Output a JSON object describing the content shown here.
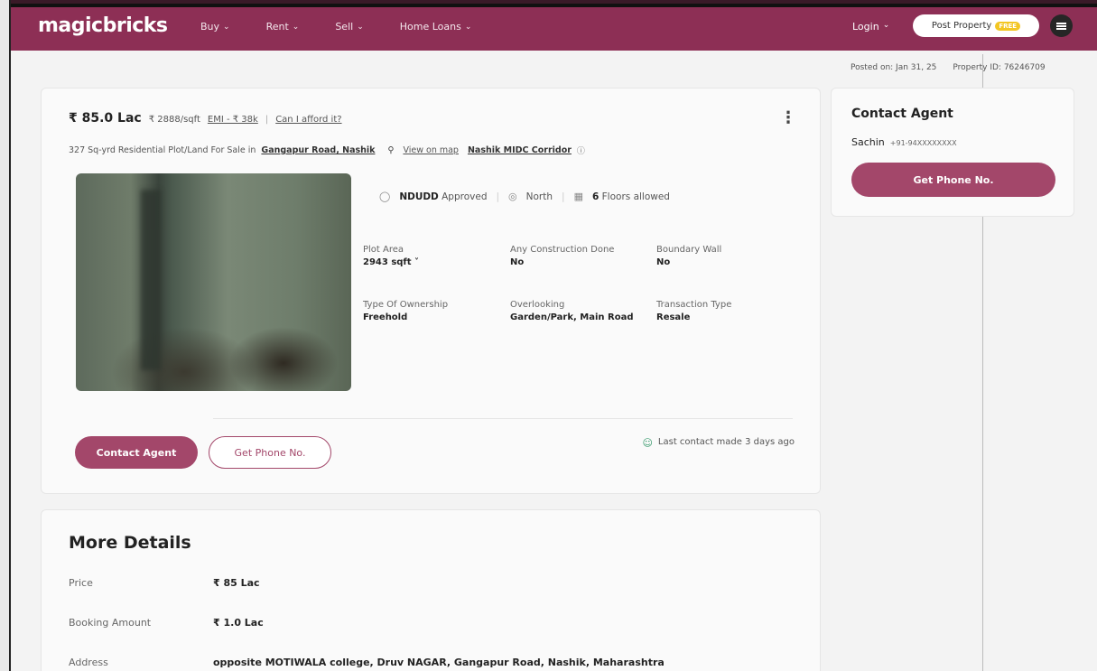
{
  "header": {
    "logo": "magicbricks",
    "nav": [
      {
        "label": "Buy"
      },
      {
        "label": "Rent"
      },
      {
        "label": "Sell"
      },
      {
        "label": "Home Loans"
      }
    ],
    "login_label": "Login",
    "post_property_label": "Post Property",
    "free_badge": "FREE"
  },
  "meta": {
    "posted": "Posted on: Jan 31, 25",
    "property_id": "Property ID: 76246709"
  },
  "listing": {
    "price": "₹ 85.0 Lac",
    "per_sqft": "₹ 2888/sqft",
    "emi": "EMI - ₹ 38k",
    "afford": "Can I afford it?",
    "description": "327 Sq-yrd Residential Plot/Land For Sale in",
    "location": "Gangapur Road, Nashik",
    "view_map": "View on map",
    "corridor": "Nashik MIDC Corridor",
    "badges": {
      "approval_bold": "NDUDD",
      "approval_rest": "Approved",
      "facing": "North",
      "floors_bold": "6",
      "floors_rest": "Floors allowed"
    },
    "attributes": [
      {
        "label": "Plot Area",
        "value": "2943 sqft ˅"
      },
      {
        "label": "Any Construction Done",
        "value": "No"
      },
      {
        "label": "Boundary Wall",
        "value": "No"
      },
      {
        "label": "Type Of Ownership",
        "value": "Freehold"
      },
      {
        "label": "Overlooking",
        "value": "Garden/Park, Main Road"
      },
      {
        "label": "Transaction Type",
        "value": "Resale"
      }
    ],
    "contact_agent_label": "Contact Agent",
    "get_phone_label": "Get Phone No.",
    "last_contact": "Last contact made 3 days ago"
  },
  "contact_card": {
    "title": "Contact Agent",
    "agent_name": "Sachin",
    "agent_phone": "+91-94XXXXXXXX",
    "button_label": "Get Phone No."
  },
  "more_details": {
    "title": "More Details",
    "rows": [
      {
        "label": "Price",
        "value": "₹ 85 Lac"
      },
      {
        "label": "Booking Amount",
        "value": "₹ 1.0 Lac"
      },
      {
        "label": "Address",
        "value": "opposite MOTIWALA college, Druv NAGAR, Gangapur Road, Nashik, Maharashtra"
      }
    ]
  }
}
